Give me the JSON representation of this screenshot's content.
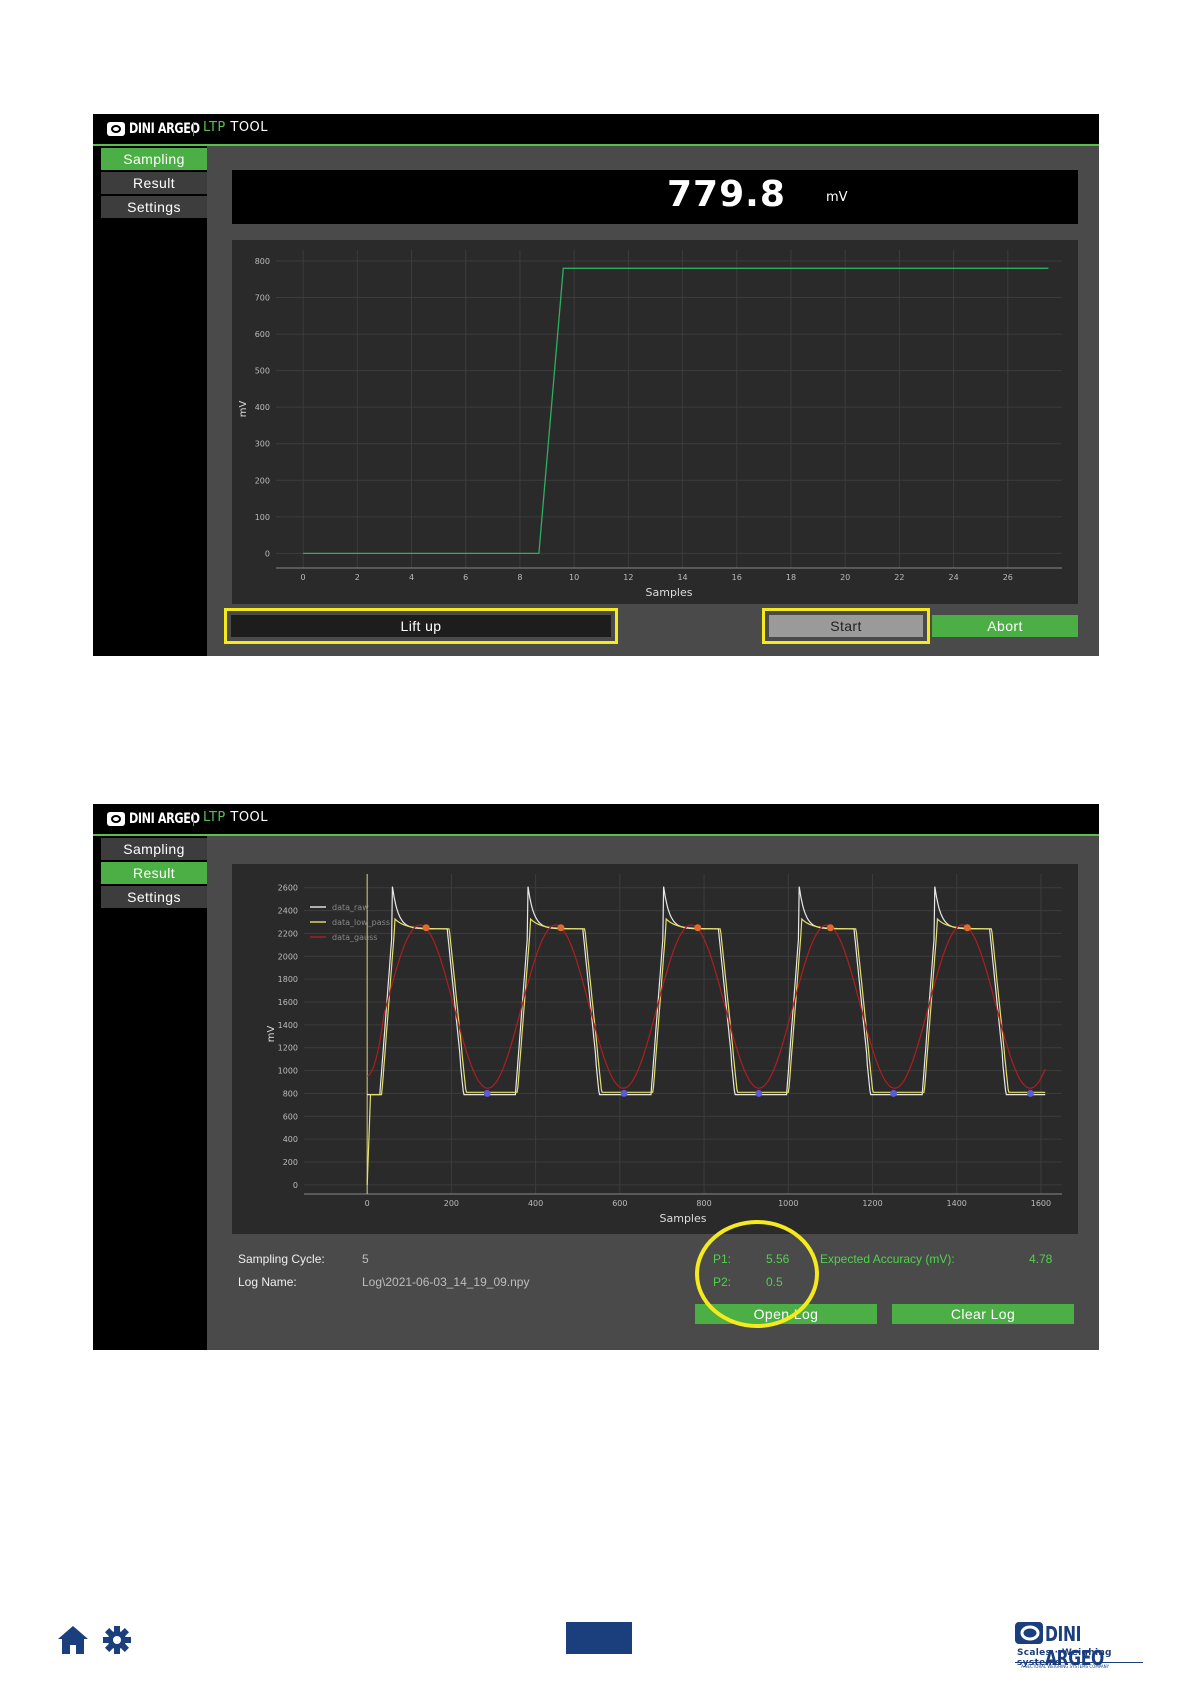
{
  "app1": {
    "brand": "DINI ARGEO",
    "title_ltp": "LTP",
    "title_tool": "TOOL",
    "nav": [
      {
        "label": "Sampling",
        "active": true
      },
      {
        "label": "Result",
        "active": false
      },
      {
        "label": "Settings",
        "active": false
      }
    ],
    "readout": {
      "value": "779.8",
      "unit": "mV"
    },
    "buttons": {
      "lift_up": "Lift up",
      "start": "Start",
      "abort": "Abort"
    }
  },
  "app2": {
    "brand": "DINI ARGEO",
    "title_ltp": "LTP",
    "title_tool": "TOOL",
    "nav": [
      {
        "label": "Sampling",
        "active": false
      },
      {
        "label": "Result",
        "active": true
      },
      {
        "label": "Settings",
        "active": false
      }
    ],
    "info": {
      "sampling_cycle_label": "Sampling Cycle:",
      "sampling_cycle_value": "5",
      "log_name_label": "Log Name:",
      "log_name_value": "Log\\2021-06-03_14_19_09.npy",
      "p1_label": "P1:",
      "p1_value": "5.56",
      "p2_label": "P2:",
      "p2_value": "0.5",
      "accuracy_label": "Expected Accuracy (mV):",
      "accuracy_value": "4.78"
    },
    "buttons": {
      "open_log": "Open Log",
      "clear_log": "Clear Log"
    }
  },
  "colors": {
    "accent": "#4caf45",
    "highlight": "#f4ea1e",
    "brand_blue": "#1b3e7c"
  },
  "footer": {
    "icons": [
      "home-icon",
      "gear-icon"
    ],
    "brand": "DINI ARGEO",
    "tagline": "Scales · Weighing systems",
    "subline": "A SECTORAL WEIGHING SYSTEMS COMPANY"
  },
  "chart_data": [
    {
      "type": "line",
      "xlabel": "Samples",
      "ylabel": "mV",
      "xlim": [
        -1,
        28
      ],
      "ylim": [
        -40,
        830
      ],
      "xticks": [
        0,
        2,
        4,
        6,
        8,
        10,
        12,
        14,
        16,
        18,
        20,
        22,
        24,
        26
      ],
      "yticks": [
        0,
        100,
        200,
        300,
        400,
        500,
        600,
        700,
        800
      ],
      "grid": true,
      "series": [
        {
          "color": "#2fae60",
          "x": [
            0,
            8.7,
            9.6,
            27.5
          ],
          "y": [
            0,
            0,
            780,
            780
          ]
        }
      ]
    },
    {
      "type": "line",
      "xlabel": "Samples",
      "ylabel": "mV",
      "xlim": [
        -150,
        1650
      ],
      "ylim": [
        -80,
        2720
      ],
      "xticks": [
        0,
        200,
        400,
        600,
        800,
        1000,
        1200,
        1400,
        1600
      ],
      "yticks": [
        0,
        200,
        400,
        600,
        800,
        1000,
        1200,
        1400,
        1600,
        1800,
        2000,
        2200,
        2400,
        2600
      ],
      "grid": true,
      "legend_position": "top-left",
      "series": [
        {
          "name": "data_raw",
          "color": "#e8e8e8",
          "period": 322,
          "low": 790,
          "high": 2240,
          "peak": 2610,
          "first_rise": 30,
          "end": 1610
        },
        {
          "name": "data_low_pass",
          "color": "#e6e06a",
          "period": 322,
          "low": 810,
          "high": 2240,
          "peak": 2330,
          "first_rise": 35,
          "end": 1610
        },
        {
          "name": "data_gauss",
          "color": "#b01e1e",
          "period": 322,
          "low": 880,
          "high": 2240,
          "start": 950,
          "end": 1610
        }
      ],
      "markers": {
        "max": {
          "color": "#e06a2e",
          "x": [
            140,
            460,
            785,
            1100,
            1425
          ],
          "y": [
            2250,
            2250,
            2250,
            2250,
            2250
          ]
        },
        "min": {
          "color": "#5b5bd6",
          "x": [
            285,
            610,
            930,
            1250,
            1575
          ],
          "y": [
            800,
            800,
            800,
            800,
            800
          ]
        }
      }
    }
  ]
}
